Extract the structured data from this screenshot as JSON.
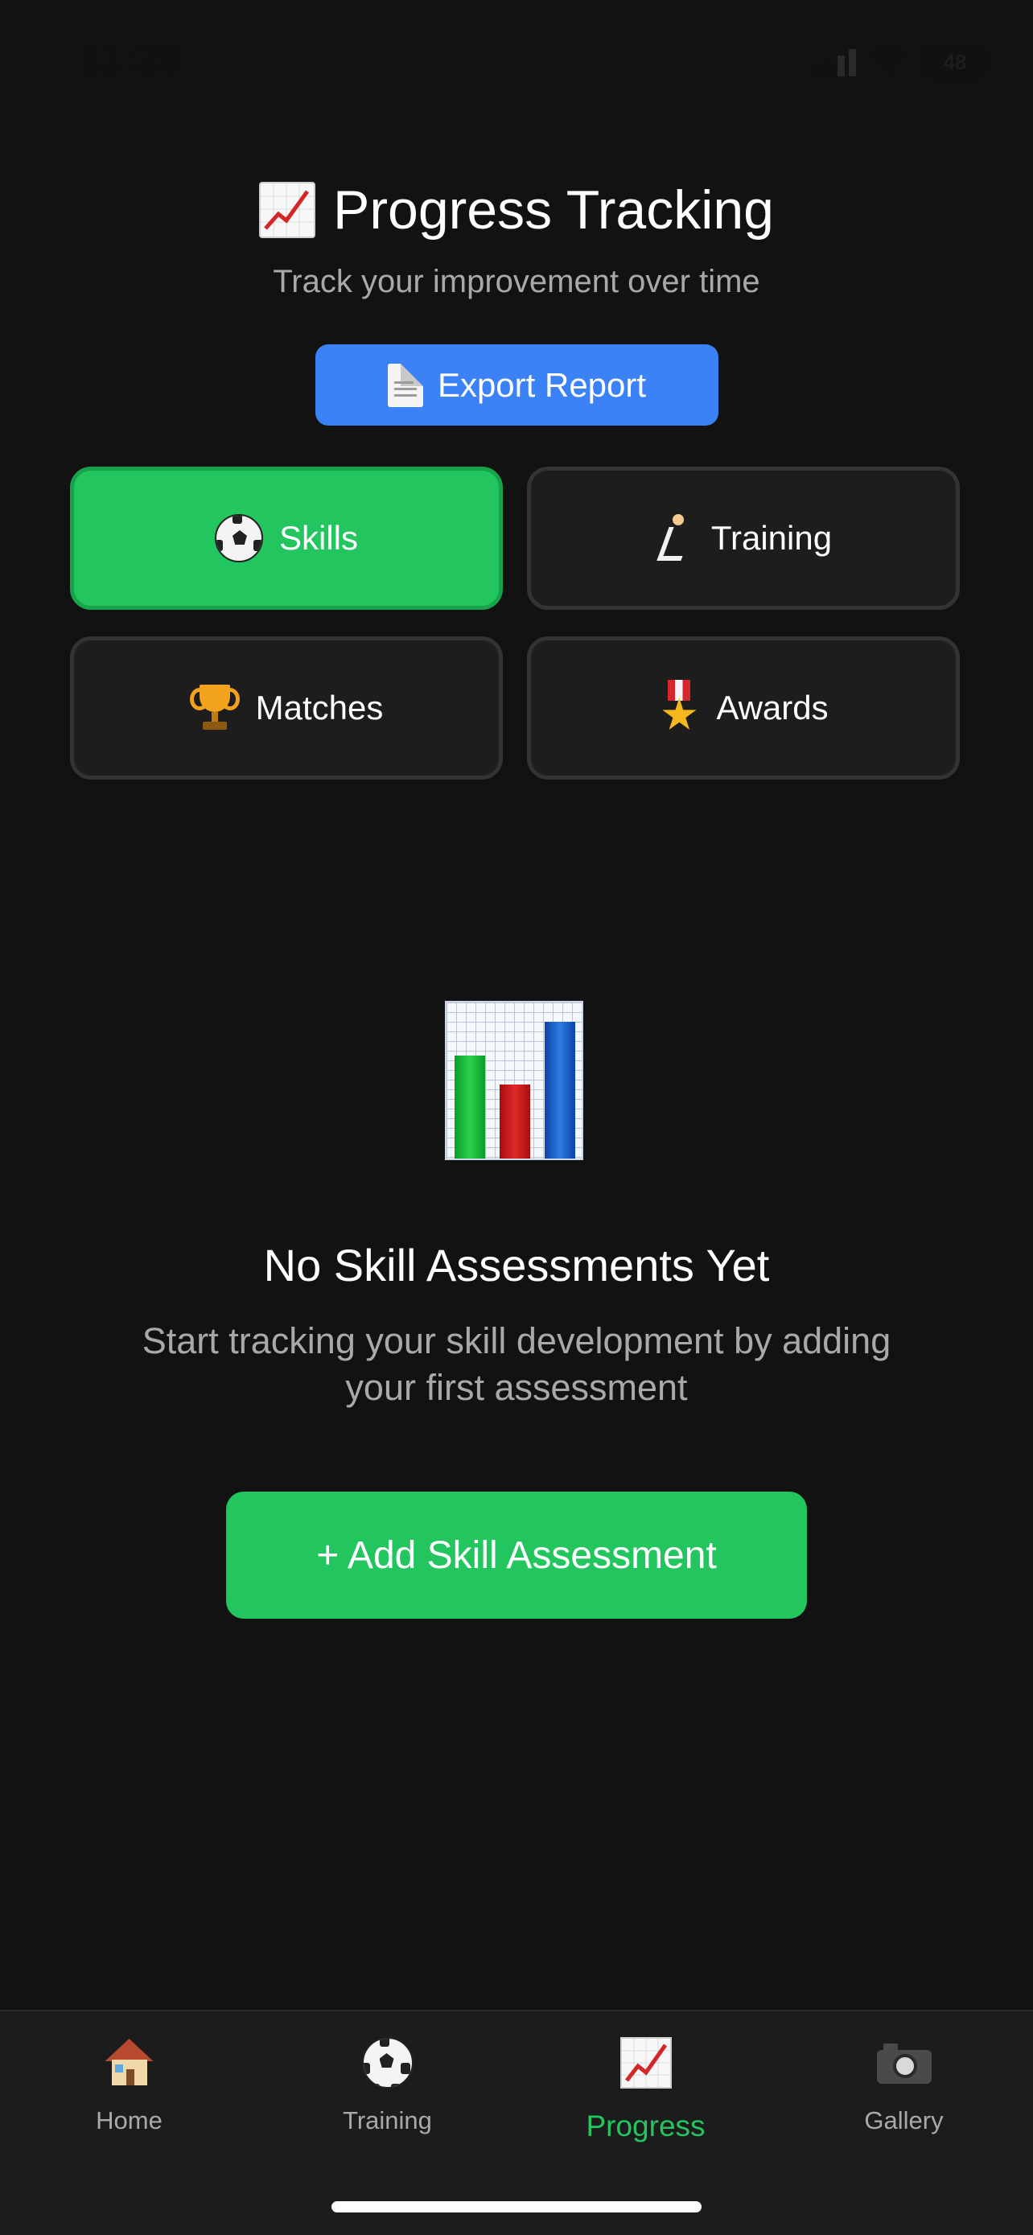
{
  "status_bar": {
    "time": "11:26",
    "battery": "48"
  },
  "header": {
    "title": "Progress Tracking",
    "subtitle": "Track your improvement over time",
    "export_label": "Export Report"
  },
  "categories": [
    {
      "label": "Skills",
      "icon": "soccer-ball-icon",
      "active": true
    },
    {
      "label": "Training",
      "icon": "runner-icon",
      "active": false
    },
    {
      "label": "Matches",
      "icon": "trophy-icon",
      "active": false
    },
    {
      "label": "Awards",
      "icon": "medal-icon",
      "active": false
    }
  ],
  "empty_state": {
    "icon": "bar-chart-icon",
    "title": "No Skill Assessments Yet",
    "description": "Start tracking your skill development by adding your first assessment",
    "action_label": "+ Add Skill Assessment"
  },
  "tab_bar": {
    "items": [
      {
        "label": "Home",
        "icon": "house-icon",
        "active": false
      },
      {
        "label": "Training",
        "icon": "soccer-ball-icon",
        "active": false
      },
      {
        "label": "Progress",
        "icon": "chart-up-icon",
        "active": true
      },
      {
        "label": "Gallery",
        "icon": "camera-icon",
        "active": false
      }
    ]
  },
  "colors": {
    "background": "#121212",
    "accent_green": "#22c55e",
    "accent_blue": "#3b82f6",
    "card_background": "#1d1d1d",
    "muted_text": "#a9a9a9"
  }
}
